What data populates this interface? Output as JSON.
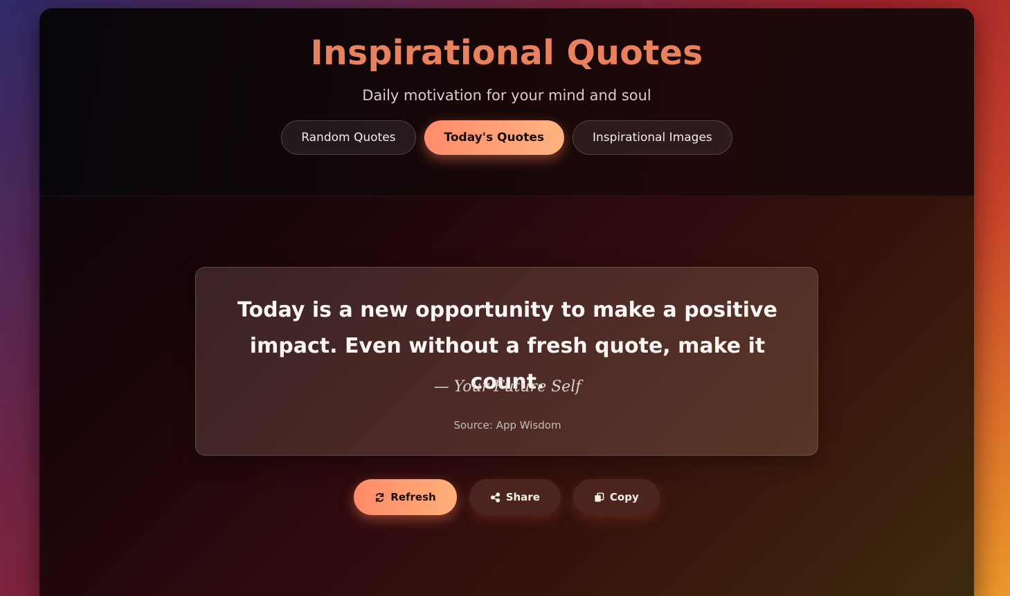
{
  "header": {
    "title": "Inspirational Quotes",
    "subtitle": "Daily motivation for your mind and soul"
  },
  "tabs": [
    {
      "label": "Random Quotes",
      "active": false
    },
    {
      "label": "Today's Quotes",
      "active": true
    },
    {
      "label": "Inspirational Images",
      "active": false
    }
  ],
  "quote": {
    "text": "Today is a new opportunity to make a positive impact. Even without a fresh quote, make it count.",
    "author": "— Your Future Self",
    "source": "Source: App Wisdom"
  },
  "actions": {
    "refresh": {
      "label": "Refresh",
      "icon": "refresh-icon"
    },
    "share": {
      "label": "Share",
      "icon": "share-icon"
    },
    "copy": {
      "label": "Copy",
      "icon": "copy-icon"
    }
  },
  "colors": {
    "accent_start": "#ff8c6b",
    "accent_end": "#ffb380",
    "title": "#e8825e"
  }
}
